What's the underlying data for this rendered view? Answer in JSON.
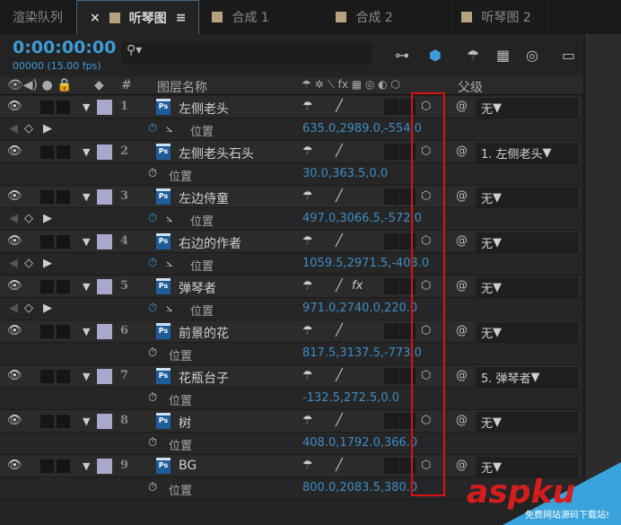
{
  "tabs": [
    {
      "label": "渲染队列"
    },
    {
      "label": "听琴图",
      "active": true
    },
    {
      "label": "合成 1"
    },
    {
      "label": "合成 2"
    },
    {
      "label": "听琴图 2"
    }
  ],
  "timecode": "0:00:00:00",
  "frame_info": "00000 (15.00 fps)",
  "search_placeholder": "",
  "header": {
    "num": "#",
    "layer_name": "图层名称",
    "parent": "父级"
  },
  "layers": [
    {
      "num": "1",
      "name": "左侧老头",
      "parent": "无",
      "prop": "位置",
      "value": "635.0,2989.0,-554.0",
      "keyframed": true
    },
    {
      "num": "2",
      "name": "左侧老头石头",
      "parent": "1. 左侧老头",
      "prop": "位置",
      "value": "30.0,363.5,0.0",
      "keyframed": false
    },
    {
      "num": "3",
      "name": "左边侍童",
      "parent": "无",
      "prop": "位置",
      "value": "497.0,3066.5,-572.0",
      "keyframed": true
    },
    {
      "num": "4",
      "name": "右边的作者",
      "parent": "无",
      "prop": "位置",
      "value": "1059.5,2971.5,-403.0",
      "keyframed": true
    },
    {
      "num": "5",
      "name": "弹琴者",
      "parent": "无",
      "prop": "位置",
      "value": "971.0,2740.0,220.0",
      "keyframed": true,
      "fx": true
    },
    {
      "num": "6",
      "name": "前景的花",
      "parent": "无",
      "prop": "位置",
      "value": "817.5,3137.5,-773.0",
      "keyframed": false
    },
    {
      "num": "7",
      "name": "花瓶台子",
      "parent": "5. 弹琴者",
      "prop": "位置",
      "value": "-132.5,272.5,0.0",
      "keyframed": false
    },
    {
      "num": "8",
      "name": "树",
      "parent": "无",
      "prop": "位置",
      "value": "408.0,1792.0,366.0",
      "keyframed": false
    },
    {
      "num": "9",
      "name": "BG",
      "parent": "无",
      "prop": "位置",
      "value": "800.0,2083.5,380.0",
      "keyframed": false
    }
  ],
  "watermark": {
    "brand": "aspku.com",
    "tagline": "免费网站源码下载站!"
  },
  "colors": {
    "accent": "#3e9bd6",
    "highlight": "#dd1111"
  }
}
